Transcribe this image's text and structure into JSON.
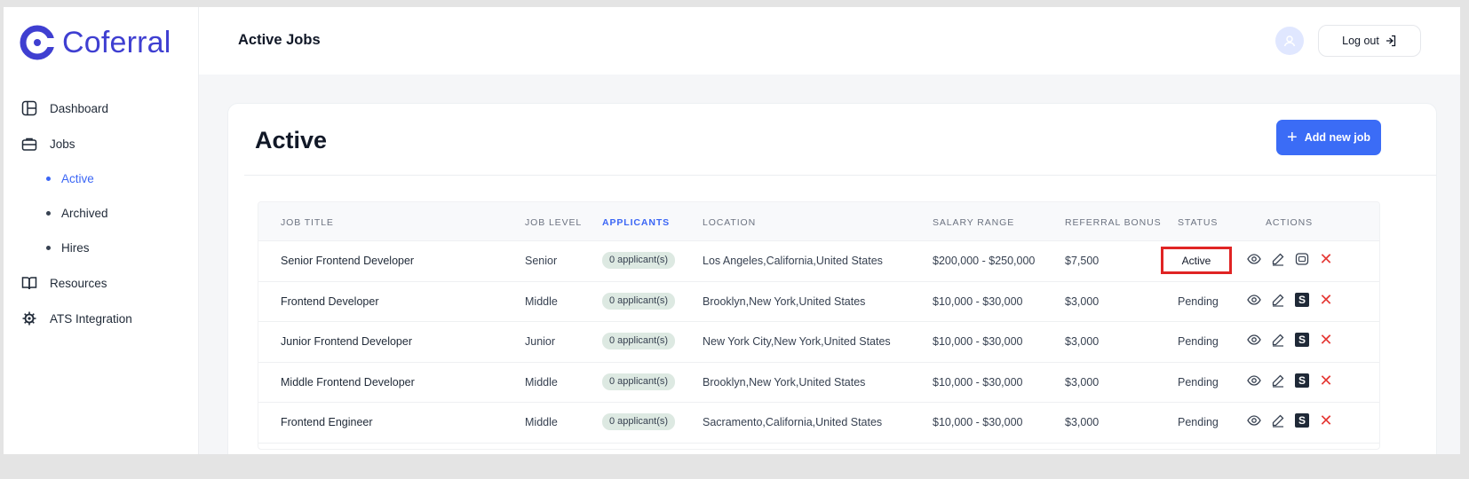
{
  "brand": {
    "name": "Coferral"
  },
  "sidebar": {
    "items": [
      {
        "label": "Dashboard",
        "icon": "dashboard-icon"
      },
      {
        "label": "Jobs",
        "icon": "briefcase-icon"
      },
      {
        "label": "Active"
      },
      {
        "label": "Archived"
      },
      {
        "label": "Hires"
      },
      {
        "label": "Resources",
        "icon": "book-icon"
      },
      {
        "label": "ATS Integration",
        "icon": "integration-icon"
      }
    ]
  },
  "header": {
    "title": "Active Jobs",
    "logout_label": "Log out"
  },
  "card": {
    "title": "Active",
    "add_button_label": "Add new job"
  },
  "table": {
    "columns": [
      "JOB TITLE",
      "JOB LEVEL",
      "APPLICANTS",
      "LOCATION",
      "SALARY RANGE",
      "REFERRAL BONUS",
      "STATUS",
      "ACTIONS"
    ],
    "rows": [
      {
        "title": "Senior Frontend Developer",
        "level": "Senior",
        "applicants": "0 applicant(s)",
        "location": "Los Angeles,California,United States",
        "salary": "$200,000 - $250,000",
        "bonus": "$7,500",
        "status": "Active"
      },
      {
        "title": "Frontend Developer",
        "level": "Middle",
        "applicants": "0 applicant(s)",
        "location": "Brooklyn,New York,United States",
        "salary": "$10,000 - $30,000",
        "bonus": "$3,000",
        "status": "Pending"
      },
      {
        "title": "Junior Frontend Developer",
        "level": "Junior",
        "applicants": "0 applicant(s)",
        "location": "New York City,New York,United States",
        "salary": "$10,000 - $30,000",
        "bonus": "$3,000",
        "status": "Pending"
      },
      {
        "title": "Middle Frontend Developer",
        "level": "Middle",
        "applicants": "0 applicant(s)",
        "location": "Brooklyn,New York,United States",
        "salary": "$10,000 - $30,000",
        "bonus": "$3,000",
        "status": "Pending"
      },
      {
        "title": "Frontend Engineer",
        "level": "Middle",
        "applicants": "0 applicant(s)",
        "location": "Sacramento,California,United States",
        "salary": "$10,000 - $30,000",
        "bonus": "$3,000",
        "status": "Pending"
      }
    ],
    "action_badge": "S"
  },
  "colors": {
    "accent": "#3b6cf6",
    "brand": "#3f3fd1",
    "highlight_border": "#e02424",
    "delete": "#e53935"
  }
}
